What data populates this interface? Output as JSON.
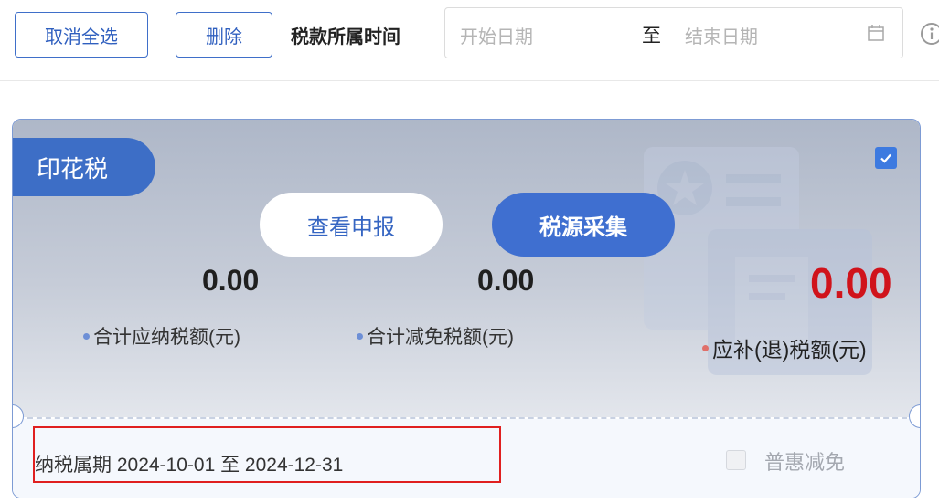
{
  "toolbar": {
    "deselect_all_label": "取消全选",
    "delete_label": "删除",
    "period_label": "税款所属时间",
    "date_start_placeholder": "开始日期",
    "date_separator": "至",
    "date_end_placeholder": "结束日期"
  },
  "card": {
    "tax_name": "印花税",
    "checked": true,
    "view_button_label": "查看申报",
    "collect_button_label": "税源采集",
    "stats": {
      "payable_value": "0.00",
      "payable_label": "合计应纳税额(元)",
      "reduction_value": "0.00",
      "reduction_label": "合计减免税额(元)",
      "refund_value": "0.00",
      "refund_label": "应补(退)税额(元)"
    },
    "period_text": "纳税属期 2024-10-01 至 2024-12-31",
    "relief_label": "普惠减免",
    "relief_checked": false
  },
  "colors": {
    "accent": "#3d6ec6",
    "highlight_red": "#d0131b",
    "dot_blue": "#6d8fd6",
    "dot_red": "#e0706a"
  },
  "icons": [
    "calendar-icon",
    "info-icon",
    "check-icon",
    "tax-document-watermark"
  ]
}
